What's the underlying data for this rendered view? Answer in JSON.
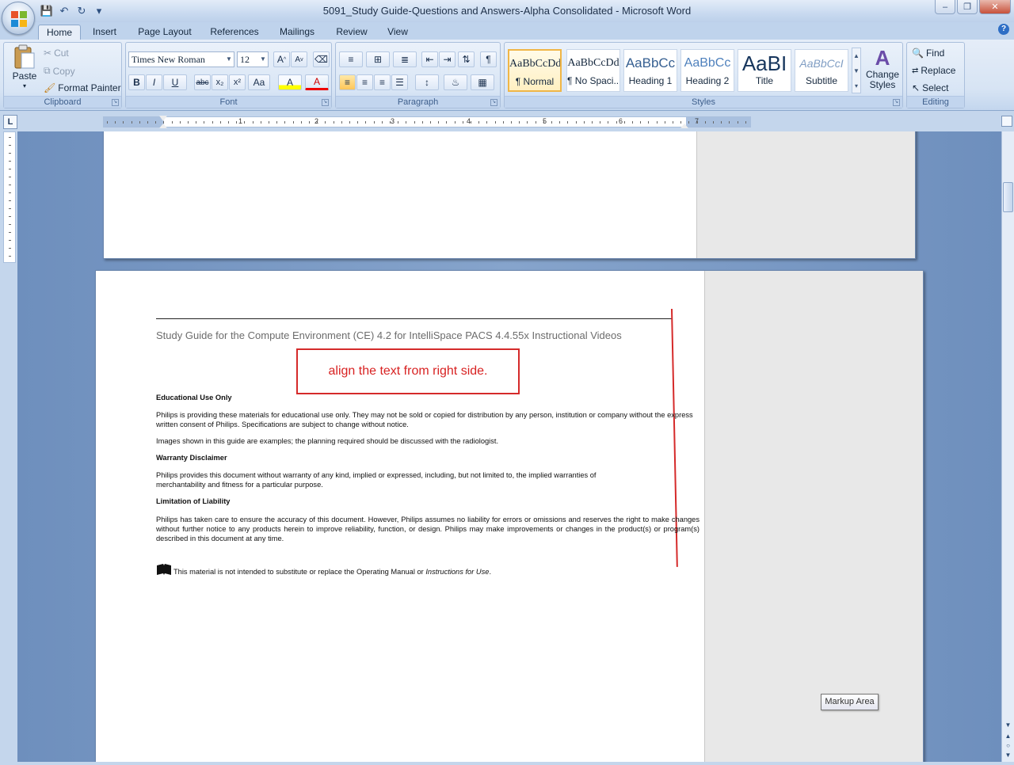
{
  "window": {
    "title": "5091_Study Guide-Questions and Answers-Alpha Consolidated - Microsoft Word",
    "controls": [
      "–",
      "❐",
      "✕"
    ]
  },
  "tabs": [
    {
      "label": "Home"
    },
    {
      "label": "Insert"
    },
    {
      "label": "Page Layout"
    },
    {
      "label": "References"
    },
    {
      "label": "Mailings"
    },
    {
      "label": "Review"
    },
    {
      "label": "View"
    }
  ],
  "clipboard": {
    "paste": "Paste",
    "cut": "Cut",
    "copy": "Copy",
    "format_painter": "Format Painter",
    "label": "Clipboard"
  },
  "font": {
    "name": "Times New Roman",
    "size": "12",
    "label": "Font",
    "buttons": [
      "B",
      "I",
      "U",
      "abc",
      "x₂",
      "x²",
      "Aa",
      "A",
      "A"
    ]
  },
  "paragraph": {
    "label": "Paragraph"
  },
  "styles": {
    "label": "Styles",
    "change_styles": "Change Styles",
    "tiles": [
      {
        "sample": "AaBbCcDd",
        "name": "¶ Normal"
      },
      {
        "sample": "AaBbCcDd",
        "name": "¶ No Spaci..."
      },
      {
        "sample": "AaBbCc",
        "name": "Heading 1"
      },
      {
        "sample": "AaBbCc",
        "name": "Heading 2"
      },
      {
        "sample": "AaBI",
        "name": "Title"
      },
      {
        "sample": "AaBbCcI",
        "name": "Subtitle"
      }
    ]
  },
  "editing": {
    "find": "Find",
    "replace": "Replace",
    "select": "Select",
    "label": "Editing"
  },
  "ruler": {
    "numbers": [
      "1",
      "2",
      "3",
      "4",
      "5",
      "6",
      "7"
    ],
    "corner": "L"
  },
  "document": {
    "header": "Study Guide for the Compute Environment (CE) 4.2 for IntelliSpace PACS 4.4.55x  Instructional Videos",
    "annotation": "align the text from right side.",
    "sections": [
      {
        "heading": "Educational Use Only"
      },
      {
        "text": "Philips is providing these materials for educational use only. They may not be sold or copied for distribution by any person, institution or company without the express written consent of Philips. Specifications are subject to change without notice."
      },
      {
        "text": "Images shown in this guide are examples; the planning required should be discussed with the radiologist."
      },
      {
        "heading": "Warranty Disclaimer"
      },
      {
        "text": "Philips provides this document without warranty of any kind, implied or expressed, including, but not limited to, the implied warranties of merchantability and fitness for a particular purpose."
      },
      {
        "heading": "Limitation of Liability"
      },
      {
        "text": "Philips has taken care to ensure the accuracy of this document. However, Philips assumes no liability for errors or omissions and reserves the right to make changes without further notice to any products herein to improve reliability, function, or design. Philips may make improvements or changes in the product(s) or program(s) described in this document at any time."
      }
    ],
    "note_prefix": "This material is not intended to substitute or replace the Operating Manual or ",
    "note_italic": "Instructions for Use",
    "note_suffix": "."
  },
  "tooltip": "Markup Area",
  "colors": {
    "annotation": "#d52a2a",
    "ribbon": "#dbe6f5",
    "workspace": "#7d9ac4"
  }
}
